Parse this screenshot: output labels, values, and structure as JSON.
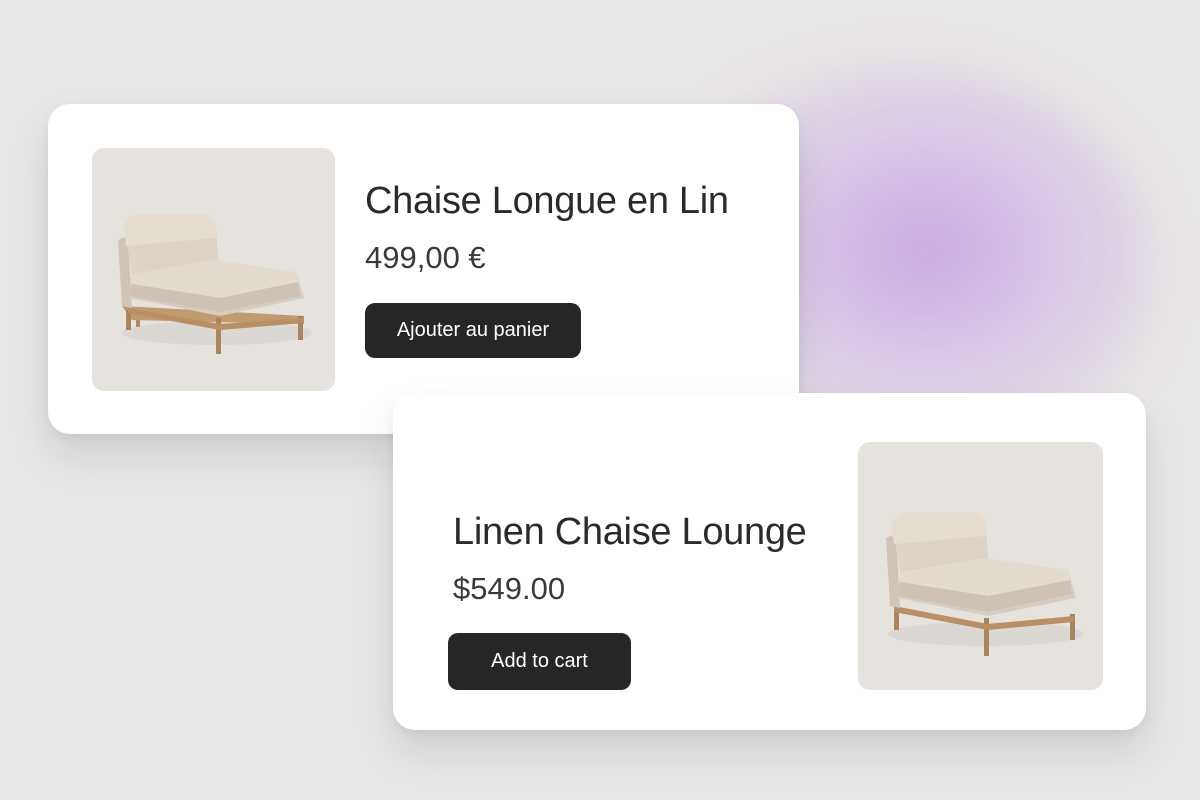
{
  "colors": {
    "background": "#e9e7e5",
    "glow": "#c4a0e4",
    "card": "#ffffff",
    "button": "#262626",
    "button_text": "#ffffff",
    "image_background": "#e6e3df"
  },
  "cards": [
    {
      "image_icon": "chaise-longue-photo",
      "title": "Chaise Longue en Lin",
      "price": "499,00 €",
      "button_label": "Ajouter au panier"
    },
    {
      "image_icon": "chaise-longue-photo",
      "title": "Linen Chaise Lounge",
      "price": "$549.00",
      "button_label": "Add to cart"
    }
  ]
}
